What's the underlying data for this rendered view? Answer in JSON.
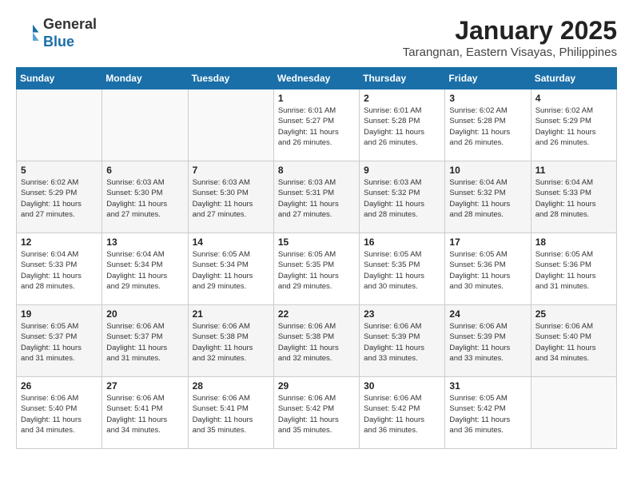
{
  "header": {
    "logo_line1": "General",
    "logo_line2": "Blue",
    "month": "January 2025",
    "location": "Tarangnan, Eastern Visayas, Philippines"
  },
  "days_of_week": [
    "Sunday",
    "Monday",
    "Tuesday",
    "Wednesday",
    "Thursday",
    "Friday",
    "Saturday"
  ],
  "weeks": [
    [
      {
        "day": "",
        "info": ""
      },
      {
        "day": "",
        "info": ""
      },
      {
        "day": "",
        "info": ""
      },
      {
        "day": "1",
        "info": "Sunrise: 6:01 AM\nSunset: 5:27 PM\nDaylight: 11 hours\nand 26 minutes."
      },
      {
        "day": "2",
        "info": "Sunrise: 6:01 AM\nSunset: 5:28 PM\nDaylight: 11 hours\nand 26 minutes."
      },
      {
        "day": "3",
        "info": "Sunrise: 6:02 AM\nSunset: 5:28 PM\nDaylight: 11 hours\nand 26 minutes."
      },
      {
        "day": "4",
        "info": "Sunrise: 6:02 AM\nSunset: 5:29 PM\nDaylight: 11 hours\nand 26 minutes."
      }
    ],
    [
      {
        "day": "5",
        "info": "Sunrise: 6:02 AM\nSunset: 5:29 PM\nDaylight: 11 hours\nand 27 minutes."
      },
      {
        "day": "6",
        "info": "Sunrise: 6:03 AM\nSunset: 5:30 PM\nDaylight: 11 hours\nand 27 minutes."
      },
      {
        "day": "7",
        "info": "Sunrise: 6:03 AM\nSunset: 5:30 PM\nDaylight: 11 hours\nand 27 minutes."
      },
      {
        "day": "8",
        "info": "Sunrise: 6:03 AM\nSunset: 5:31 PM\nDaylight: 11 hours\nand 27 minutes."
      },
      {
        "day": "9",
        "info": "Sunrise: 6:03 AM\nSunset: 5:32 PM\nDaylight: 11 hours\nand 28 minutes."
      },
      {
        "day": "10",
        "info": "Sunrise: 6:04 AM\nSunset: 5:32 PM\nDaylight: 11 hours\nand 28 minutes."
      },
      {
        "day": "11",
        "info": "Sunrise: 6:04 AM\nSunset: 5:33 PM\nDaylight: 11 hours\nand 28 minutes."
      }
    ],
    [
      {
        "day": "12",
        "info": "Sunrise: 6:04 AM\nSunset: 5:33 PM\nDaylight: 11 hours\nand 28 minutes."
      },
      {
        "day": "13",
        "info": "Sunrise: 6:04 AM\nSunset: 5:34 PM\nDaylight: 11 hours\nand 29 minutes."
      },
      {
        "day": "14",
        "info": "Sunrise: 6:05 AM\nSunset: 5:34 PM\nDaylight: 11 hours\nand 29 minutes."
      },
      {
        "day": "15",
        "info": "Sunrise: 6:05 AM\nSunset: 5:35 PM\nDaylight: 11 hours\nand 29 minutes."
      },
      {
        "day": "16",
        "info": "Sunrise: 6:05 AM\nSunset: 5:35 PM\nDaylight: 11 hours\nand 30 minutes."
      },
      {
        "day": "17",
        "info": "Sunrise: 6:05 AM\nSunset: 5:36 PM\nDaylight: 11 hours\nand 30 minutes."
      },
      {
        "day": "18",
        "info": "Sunrise: 6:05 AM\nSunset: 5:36 PM\nDaylight: 11 hours\nand 31 minutes."
      }
    ],
    [
      {
        "day": "19",
        "info": "Sunrise: 6:05 AM\nSunset: 5:37 PM\nDaylight: 11 hours\nand 31 minutes."
      },
      {
        "day": "20",
        "info": "Sunrise: 6:06 AM\nSunset: 5:37 PM\nDaylight: 11 hours\nand 31 minutes."
      },
      {
        "day": "21",
        "info": "Sunrise: 6:06 AM\nSunset: 5:38 PM\nDaylight: 11 hours\nand 32 minutes."
      },
      {
        "day": "22",
        "info": "Sunrise: 6:06 AM\nSunset: 5:38 PM\nDaylight: 11 hours\nand 32 minutes."
      },
      {
        "day": "23",
        "info": "Sunrise: 6:06 AM\nSunset: 5:39 PM\nDaylight: 11 hours\nand 33 minutes."
      },
      {
        "day": "24",
        "info": "Sunrise: 6:06 AM\nSunset: 5:39 PM\nDaylight: 11 hours\nand 33 minutes."
      },
      {
        "day": "25",
        "info": "Sunrise: 6:06 AM\nSunset: 5:40 PM\nDaylight: 11 hours\nand 34 minutes."
      }
    ],
    [
      {
        "day": "26",
        "info": "Sunrise: 6:06 AM\nSunset: 5:40 PM\nDaylight: 11 hours\nand 34 minutes."
      },
      {
        "day": "27",
        "info": "Sunrise: 6:06 AM\nSunset: 5:41 PM\nDaylight: 11 hours\nand 34 minutes."
      },
      {
        "day": "28",
        "info": "Sunrise: 6:06 AM\nSunset: 5:41 PM\nDaylight: 11 hours\nand 35 minutes."
      },
      {
        "day": "29",
        "info": "Sunrise: 6:06 AM\nSunset: 5:42 PM\nDaylight: 11 hours\nand 35 minutes."
      },
      {
        "day": "30",
        "info": "Sunrise: 6:06 AM\nSunset: 5:42 PM\nDaylight: 11 hours\nand 36 minutes."
      },
      {
        "day": "31",
        "info": "Sunrise: 6:05 AM\nSunset: 5:42 PM\nDaylight: 11 hours\nand 36 minutes."
      },
      {
        "day": "",
        "info": ""
      }
    ]
  ]
}
